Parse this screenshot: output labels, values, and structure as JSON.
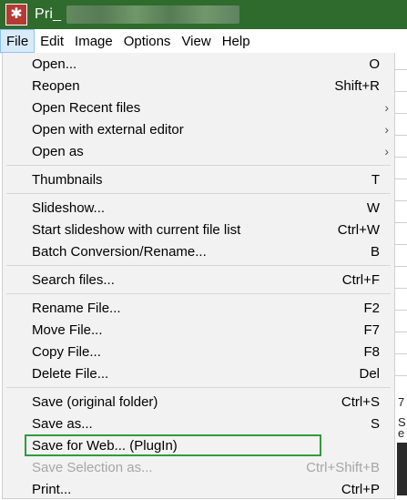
{
  "window": {
    "title": "Pri_",
    "icon": "app-icon"
  },
  "menubar": {
    "items": [
      {
        "label": "File",
        "active": true
      },
      {
        "label": "Edit"
      },
      {
        "label": "Image"
      },
      {
        "label": "Options"
      },
      {
        "label": "View"
      },
      {
        "label": "Help"
      }
    ]
  },
  "file_menu": {
    "groups": [
      [
        {
          "label": "Open...",
          "shortcut": "O"
        },
        {
          "label": "Reopen",
          "shortcut": "Shift+R"
        },
        {
          "label": "Open Recent files",
          "submenu": true
        },
        {
          "label": "Open with external editor",
          "submenu": true
        },
        {
          "label": "Open as",
          "submenu": true
        }
      ],
      [
        {
          "label": "Thumbnails",
          "shortcut": "T"
        }
      ],
      [
        {
          "label": "Slideshow...",
          "shortcut": "W"
        },
        {
          "label": "Start slideshow with current file list",
          "shortcut": "Ctrl+W"
        },
        {
          "label": "Batch Conversion/Rename...",
          "shortcut": "B"
        }
      ],
      [
        {
          "label": "Search files...",
          "shortcut": "Ctrl+F"
        }
      ],
      [
        {
          "label": "Rename File...",
          "shortcut": "F2"
        },
        {
          "label": "Move File...",
          "shortcut": "F7"
        },
        {
          "label": "Copy File...",
          "shortcut": "F8"
        },
        {
          "label": "Delete File...",
          "shortcut": "Del"
        }
      ],
      [
        {
          "label": "Save (original folder)",
          "shortcut": "Ctrl+S"
        },
        {
          "label": "Save as...",
          "shortcut": "S"
        },
        {
          "label": "Save for Web... (PlugIn)",
          "selected": true
        },
        {
          "label": "Save Selection as...",
          "shortcut": "Ctrl+Shift+B",
          "disabled": true
        },
        {
          "label": "Print...",
          "shortcut": "Ctrl+P"
        }
      ]
    ]
  },
  "background_edge": {
    "texts": [
      "7",
      "S",
      "e"
    ]
  },
  "colors": {
    "titlebar": "#2f6b2c",
    "menu_bg": "#f2f2f2",
    "active_menu": "#d8ebfb",
    "selection_outline": "#2f9b3e",
    "disabled_text": "#a6a6a6"
  }
}
